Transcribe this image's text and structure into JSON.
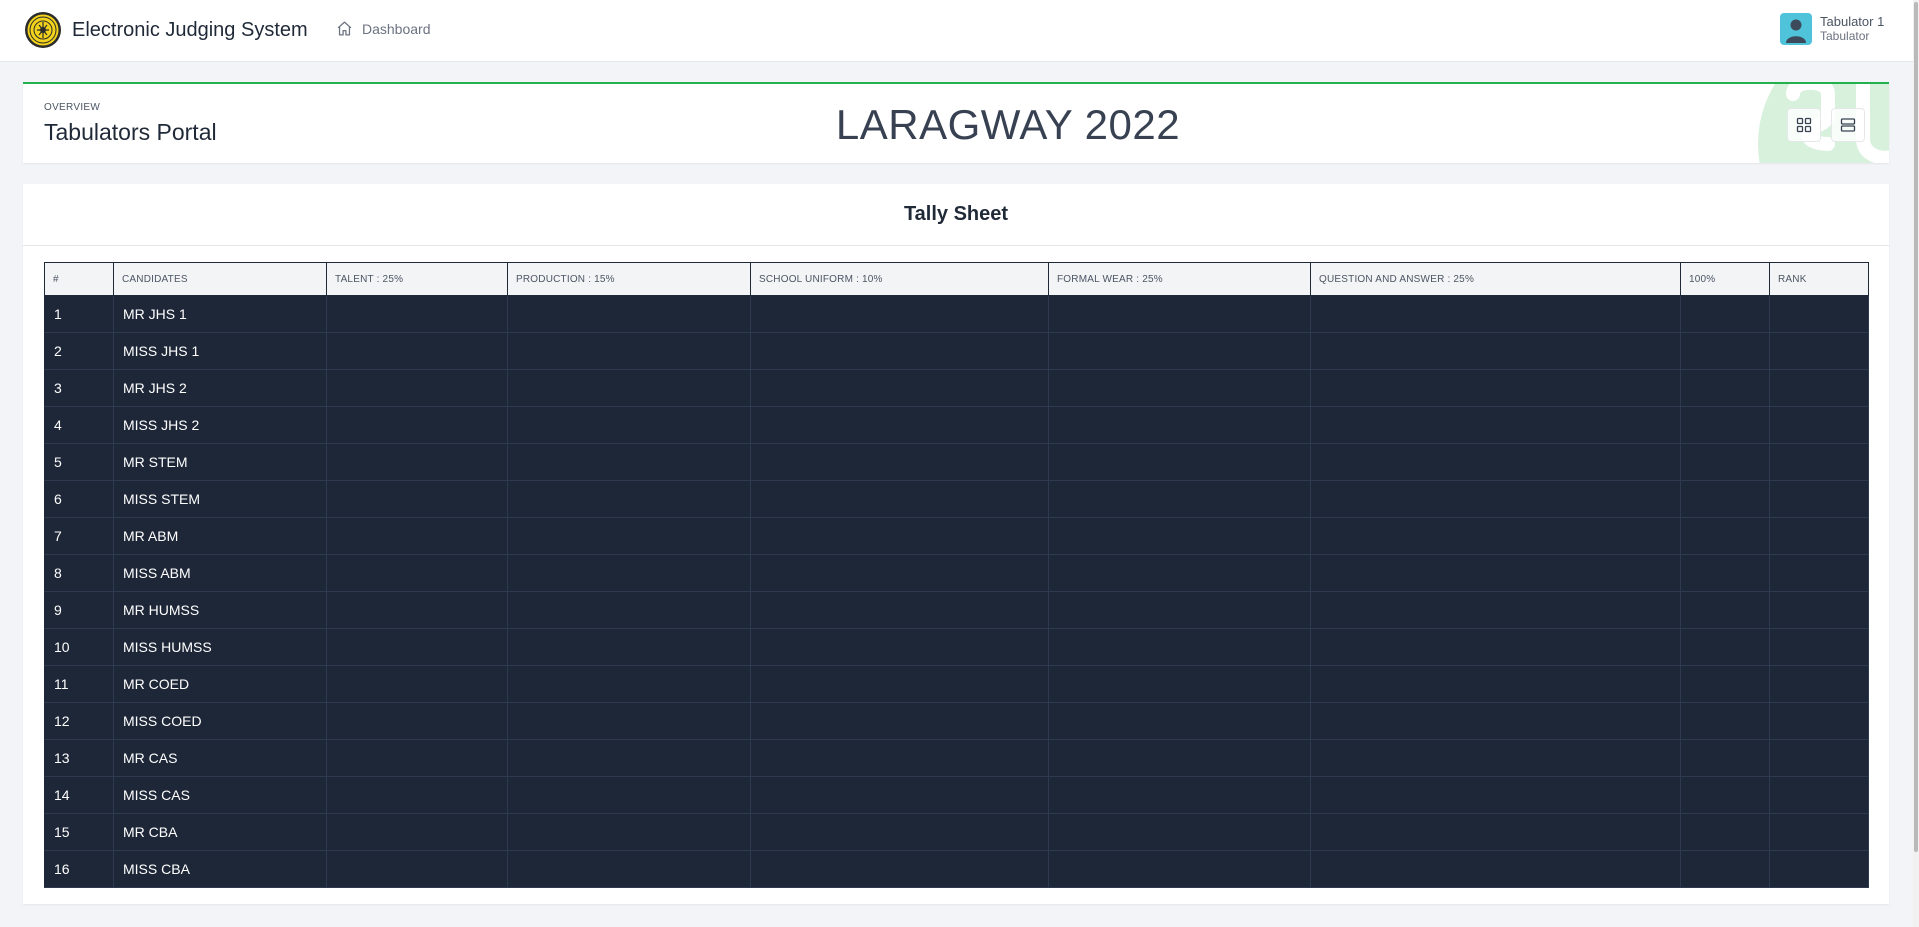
{
  "app": {
    "title": "Electronic Judging System",
    "logo_icon": "school-seal-logo"
  },
  "nav": {
    "dashboard_label": "Dashboard",
    "dashboard_icon": "home-icon"
  },
  "user": {
    "name": "Tabulator 1",
    "role": "Tabulator",
    "avatar_color": "#4fc3d9"
  },
  "header": {
    "overview_label": "OVERVIEW",
    "portal_title": "Tabulators Portal",
    "event_title": "LARAGWAY 2022",
    "accent_color": "#22b14c",
    "buttons": [
      {
        "name": "grid-view-button",
        "icon": "grid-icon"
      },
      {
        "name": "list-view-button",
        "icon": "list-icon"
      }
    ]
  },
  "tally": {
    "title": "Tally Sheet",
    "columns": [
      "#",
      "CANDIDATES",
      "TALENT : 25%",
      "PRODUCTION : 15%",
      "SCHOOL UNIFORM : 10%",
      "FORMAL WEAR : 25%",
      "QUESTION AND ANSWER : 25%",
      "100%",
      "RANK"
    ],
    "rows": [
      {
        "num": "1",
        "candidate": "MR JHS 1",
        "talent": "",
        "production": "",
        "uniform": "",
        "formal": "",
        "qa": "",
        "total": "",
        "rank": ""
      },
      {
        "num": "2",
        "candidate": "MISS JHS 1",
        "talent": "",
        "production": "",
        "uniform": "",
        "formal": "",
        "qa": "",
        "total": "",
        "rank": ""
      },
      {
        "num": "3",
        "candidate": "MR JHS 2",
        "talent": "",
        "production": "",
        "uniform": "",
        "formal": "",
        "qa": "",
        "total": "",
        "rank": ""
      },
      {
        "num": "4",
        "candidate": "MISS JHS 2",
        "talent": "",
        "production": "",
        "uniform": "",
        "formal": "",
        "qa": "",
        "total": "",
        "rank": ""
      },
      {
        "num": "5",
        "candidate": "MR STEM",
        "talent": "",
        "production": "",
        "uniform": "",
        "formal": "",
        "qa": "",
        "total": "",
        "rank": ""
      },
      {
        "num": "6",
        "candidate": "MISS STEM",
        "talent": "",
        "production": "",
        "uniform": "",
        "formal": "",
        "qa": "",
        "total": "",
        "rank": ""
      },
      {
        "num": "7",
        "candidate": "MR ABM",
        "talent": "",
        "production": "",
        "uniform": "",
        "formal": "",
        "qa": "",
        "total": "",
        "rank": ""
      },
      {
        "num": "8",
        "candidate": "MISS ABM",
        "talent": "",
        "production": "",
        "uniform": "",
        "formal": "",
        "qa": "",
        "total": "",
        "rank": ""
      },
      {
        "num": "9",
        "candidate": "MR HUMSS",
        "talent": "",
        "production": "",
        "uniform": "",
        "formal": "",
        "qa": "",
        "total": "",
        "rank": ""
      },
      {
        "num": "10",
        "candidate": "MISS HUMSS",
        "talent": "",
        "production": "",
        "uniform": "",
        "formal": "",
        "qa": "",
        "total": "",
        "rank": ""
      },
      {
        "num": "11",
        "candidate": "MR COED",
        "talent": "",
        "production": "",
        "uniform": "",
        "formal": "",
        "qa": "",
        "total": "",
        "rank": ""
      },
      {
        "num": "12",
        "candidate": "MISS COED",
        "talent": "",
        "production": "",
        "uniform": "",
        "formal": "",
        "qa": "",
        "total": "",
        "rank": ""
      },
      {
        "num": "13",
        "candidate": "MR CAS",
        "talent": "",
        "production": "",
        "uniform": "",
        "formal": "",
        "qa": "",
        "total": "",
        "rank": ""
      },
      {
        "num": "14",
        "candidate": "MISS CAS",
        "talent": "",
        "production": "",
        "uniform": "",
        "formal": "",
        "qa": "",
        "total": "",
        "rank": ""
      },
      {
        "num": "15",
        "candidate": "MR CBA",
        "talent": "",
        "production": "",
        "uniform": "",
        "formal": "",
        "qa": "",
        "total": "",
        "rank": ""
      },
      {
        "num": "16",
        "candidate": "MISS CBA",
        "talent": "",
        "production": "",
        "uniform": "",
        "formal": "",
        "qa": "",
        "total": "",
        "rank": ""
      }
    ],
    "row_color": "#1e2738",
    "header_color": "#f3f4f6"
  }
}
